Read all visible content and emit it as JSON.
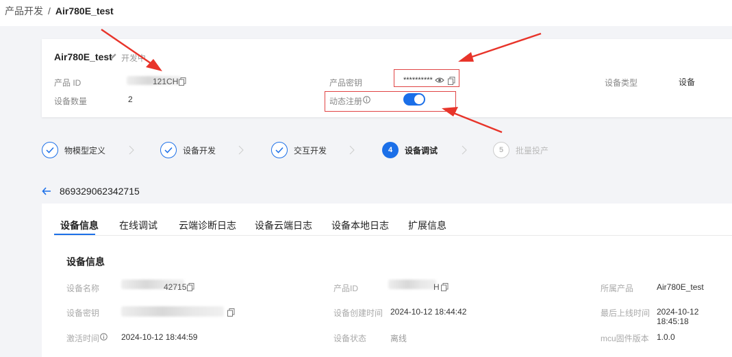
{
  "breadcrumb": {
    "parent": "产品开发",
    "separator": "/",
    "current": "Air780E_test"
  },
  "product": {
    "name": "Air780E_test",
    "tag": "开发中",
    "id_label": "产品 ID",
    "id_value_visible": "121CH",
    "secret_label": "产品密钥",
    "secret_value": "**********",
    "type_label": "设备类型",
    "type_value": "设备",
    "count_label": "设备数量",
    "count_value": "2",
    "dynamic_reg_label": "动态注册",
    "dynamic_reg_enabled": true
  },
  "steps": [
    {
      "num": "",
      "label": "物模型定义",
      "state": "done"
    },
    {
      "num": "",
      "label": "设备开发",
      "state": "done"
    },
    {
      "num": "",
      "label": "交互开发",
      "state": "done"
    },
    {
      "num": "4",
      "label": "设备调试",
      "state": "active"
    },
    {
      "num": "5",
      "label": "批量投产",
      "state": "pending"
    }
  ],
  "device": {
    "id": "869329062342715"
  },
  "tabs": [
    {
      "label": "设备信息",
      "active": true
    },
    {
      "label": "在线调试",
      "active": false
    },
    {
      "label": "云端诊断日志",
      "active": false
    },
    {
      "label": "设备云端日志",
      "active": false
    },
    {
      "label": "设备本地日志",
      "active": false
    },
    {
      "label": "扩展信息",
      "active": false
    }
  ],
  "info": {
    "title": "设备信息",
    "device_name_label": "设备名称",
    "device_name_visible": "42715",
    "device_secret_label": "设备密钥",
    "activated_label": "激活时间",
    "activated_value": "2024-10-12 18:44:59",
    "product_id_label": "产品ID",
    "product_id_visible": "H",
    "created_label": "设备创建时间",
    "created_value": "2024-10-12 18:44:42",
    "status_label": "设备状态",
    "status_value": "离线",
    "belongs_label": "所属产品",
    "belongs_value": "Air780E_test",
    "last_online_label": "最后上线时间",
    "last_online_value": "2024-10-12 18:45:18",
    "mcu_label": "mcu固件版本",
    "mcu_value": "1.0.0"
  },
  "colors": {
    "primary": "#1b6fe8",
    "annotation_red": "#e04343"
  }
}
